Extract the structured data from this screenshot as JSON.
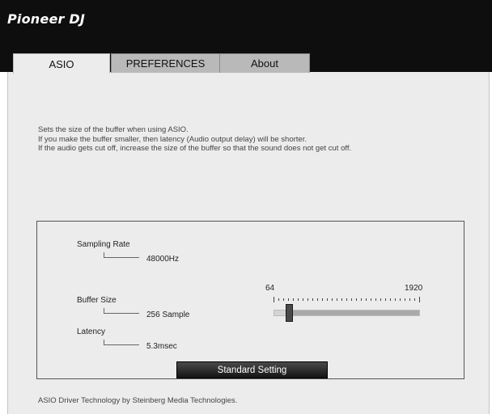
{
  "app": {
    "logo_text": "Pioneer DJ"
  },
  "tabs": [
    {
      "label": "ASIO",
      "active": true
    },
    {
      "label": "PREFERENCES",
      "active": false
    },
    {
      "label": "About",
      "active": false
    }
  ],
  "description": [
    "Sets the size of the buffer when using ASIO.",
    "If you make the buffer smaller, then latency (Audio output delay) will be shorter.",
    "If the audio gets cut off, increase the size of the buffer so that the sound does not get cut off."
  ],
  "settings": {
    "sampling_rate_label": "Sampling Rate",
    "sampling_rate_value": "48000Hz",
    "buffer_size_label": "Buffer Size",
    "buffer_size_value": "256 Sample",
    "latency_label": "Latency",
    "latency_value": "5.3msec"
  },
  "slider": {
    "min_label": "64",
    "max_label": "1920",
    "position_fraction": 0.1
  },
  "buttons": {
    "standard_setting": "Standard Setting"
  },
  "footer": "ASIO Driver Technology by Steinberg Media Technologies.",
  "colors": {
    "title_bar": "#0e0e0e",
    "panel_bg": "#ececec",
    "button_bg": "#1c1c1c"
  }
}
